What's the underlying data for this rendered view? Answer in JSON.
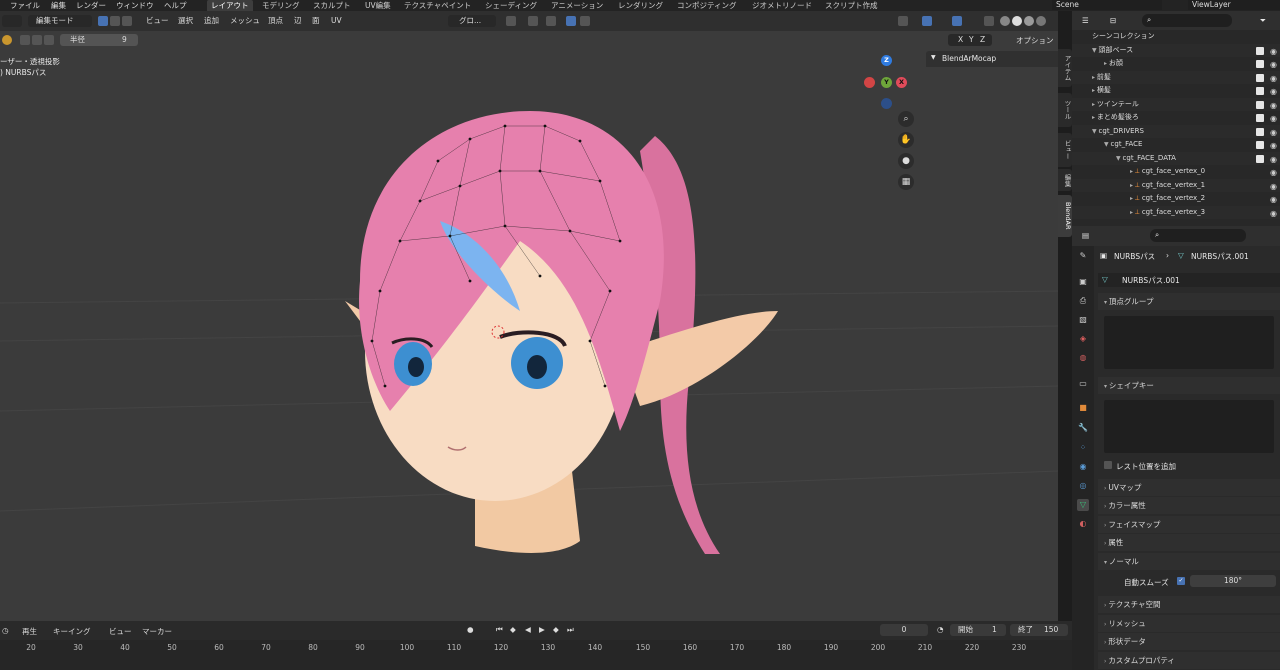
{
  "menu": {
    "items": [
      "ファイル",
      "編集",
      "レンダー",
      "ウィンドウ",
      "ヘルプ"
    ],
    "workspaces": [
      "レイアウト",
      "モデリング",
      "スカルプト",
      "UV編集",
      "テクスチャペイント",
      "シェーディング",
      "アニメーション",
      "レンダリング",
      "コンポジティング",
      "ジオメトリノード",
      "スクリプト作成"
    ],
    "scene": "Scene",
    "view_layer": "ViewLayer"
  },
  "viewport_header": {
    "mode": "編集モード",
    "menus": [
      "ビュー",
      "選択",
      "追加",
      "メッシュ",
      "頂点",
      "辺",
      "面",
      "UV"
    ],
    "orientation": "グロ...",
    "radius_label": "半径",
    "radius_value": "9",
    "axes": [
      "X",
      "Y",
      "Z"
    ],
    "options": "オプション"
  },
  "overlay": {
    "view_name": "ーザー・透視投影",
    "object_name": ") NURBSパス"
  },
  "gizmo": {
    "x": "X",
    "y": "Y",
    "z": "Z"
  },
  "n_panel": {
    "title": "BlendArMocap",
    "tabs": [
      "アイテム",
      "ツール",
      "ビュー",
      "編集",
      "BlendAR"
    ]
  },
  "timeline": {
    "menus": [
      "再生",
      "キーイング",
      "ビュー",
      "マーカー"
    ],
    "current_frame": "0",
    "start_label": "開始",
    "start_value": "1",
    "end_label": "終了",
    "end_value": "150",
    "ticks": [
      "20",
      "30",
      "40",
      "50",
      "60",
      "70",
      "80",
      "90",
      "100",
      "110",
      "120",
      "130",
      "140",
      "150",
      "160",
      "170",
      "180",
      "190",
      "200",
      "210",
      "220",
      "230"
    ]
  },
  "outliner": {
    "rows": [
      {
        "label": "シーンコレクション",
        "indent": 0
      },
      {
        "label": "頭部ベース",
        "indent": 1
      },
      {
        "label": "お顔",
        "indent": 2
      },
      {
        "label": "前髪",
        "indent": 1
      },
      {
        "label": "横髪",
        "indent": 1
      },
      {
        "label": "ツインテール",
        "indent": 1
      },
      {
        "label": "まとめ髪後ろ",
        "indent": 1
      },
      {
        "label": "cgt_DRIVERS",
        "indent": 1
      },
      {
        "label": "cgt_FACE",
        "indent": 2
      },
      {
        "label": "cgt_FACE_DATA",
        "indent": 3
      },
      {
        "label": "cgt_face_vertex_0",
        "indent": 4
      },
      {
        "label": "cgt_face_vertex_1",
        "indent": 4
      },
      {
        "label": "cgt_face_vertex_2",
        "indent": 4
      },
      {
        "label": "cgt_face_vertex_3",
        "indent": 4
      }
    ]
  },
  "properties": {
    "breadcrumb_object": "NURBSパス",
    "breadcrumb_data": "NURBSパス.001",
    "data_name": "NURBSパス.001",
    "panels": {
      "vertex_groups": "頂点グループ",
      "shape_keys": "シェイプキー",
      "relative": "レスト位置を追加",
      "uv_maps": "UVマップ",
      "color_attributes": "カラー属性",
      "face_maps": "フェイスマップ",
      "attributes": "属性",
      "normals": "ノーマル",
      "auto_smooth_label": "自動スムーズ",
      "auto_smooth_angle": "180°",
      "texture_space": "テクスチャ空間",
      "remesh": "リメッシュ",
      "shape_data": "形状データ",
      "custom_props": "カスタムプロパティ"
    }
  }
}
